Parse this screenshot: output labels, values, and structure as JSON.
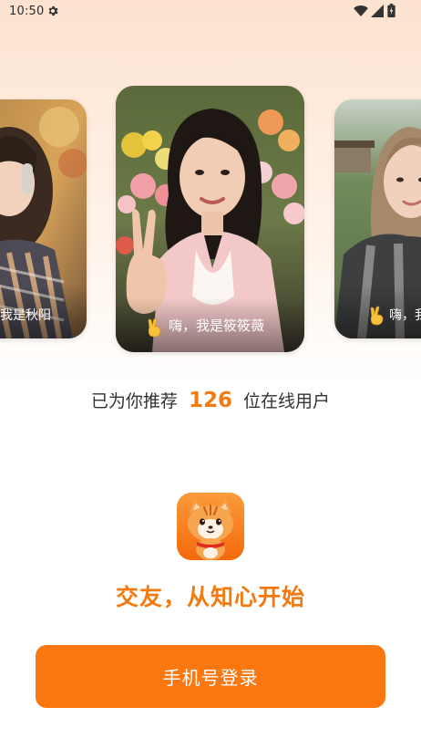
{
  "status_bar": {
    "time": "10:50",
    "settings_icon": "gear-icon",
    "wifi_icon": "wifi-icon",
    "signal_icon": "signal-icon",
    "battery_icon": "battery-icon"
  },
  "carousel": {
    "cards": [
      {
        "position": "left",
        "caption": "我是秋阳",
        "emoji": ""
      },
      {
        "position": "center",
        "caption": "嗨，我是筱筱薇",
        "emoji": "victory-hand-icon"
      },
      {
        "position": "right",
        "caption": "嗨，我",
        "emoji": "victory-hand-icon"
      }
    ]
  },
  "recommend": {
    "prefix": "已为你推荐",
    "count": "126",
    "suffix": "位在线用户"
  },
  "brand": {
    "logo_icon": "tiger-mascot-icon",
    "slogan": "交友，从知心开始"
  },
  "login": {
    "button_label": "手机号登录"
  },
  "colors": {
    "accent": "#fb7710",
    "slogan": "#f27a10",
    "background_top": "#fde3cf"
  }
}
